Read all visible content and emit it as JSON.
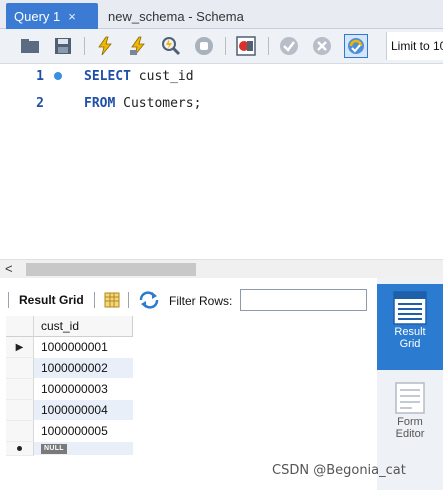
{
  "tabs": [
    {
      "label": "Query 1",
      "active": true,
      "close_glyph": "×"
    },
    {
      "label": "new_schema - Schema",
      "active": false
    }
  ],
  "toolbar": {
    "icons": [
      "open-folder-icon",
      "save-icon",
      "execute-icon",
      "execute-current-icon",
      "explain-icon",
      "stop-icon",
      "toggle-error-icon",
      "commit-icon",
      "rollback-icon",
      "autocommit-icon"
    ],
    "limit_label": "Limit to 10"
  },
  "editor": {
    "lines": [
      {
        "number": "1",
        "has_marker": true,
        "keyword": "SELECT",
        "rest": " cust_id"
      },
      {
        "number": "2",
        "has_marker": false,
        "keyword": "FROM",
        "rest": " Customers;"
      }
    ]
  },
  "scrollbar": {
    "left_arrow": "<"
  },
  "result_toolbar": {
    "result_grid_label": "Result Grid",
    "filter_label": "Filter Rows:",
    "filter_value": ""
  },
  "grid": {
    "columns": [
      "cust_id"
    ],
    "rows": [
      "1000000001",
      "1000000002",
      "1000000003",
      "1000000004",
      "1000000005"
    ],
    "current_row_marker": "▶",
    "null_label": "NULL"
  },
  "side_panel": {
    "result_grid": {
      "line1": "Result",
      "line2": "Grid"
    },
    "form_editor": {
      "line1": "Form",
      "line2": "Editor"
    }
  },
  "colors": {
    "accent": "#2b7bd1",
    "keyword": "#1f4fa8",
    "row_alt": "#e9eff9"
  },
  "watermark": "CSDN @Begonia_cat"
}
